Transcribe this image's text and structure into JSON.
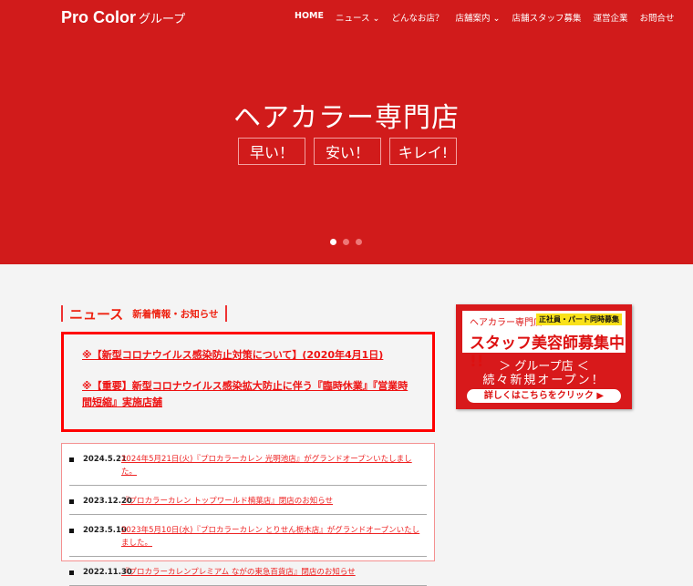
{
  "header": {
    "logo": "Pro Color",
    "logo_sub": "グループ",
    "nav": [
      "HOME",
      "ニュース ⌄",
      "どんなお店？",
      "店舗案内 ⌄",
      "店舗スタッフ募集",
      "運営企業",
      "お問合せ"
    ]
  },
  "hero": {
    "title": "ヘアカラー専門店",
    "taglines": [
      "早い！",
      "安い！",
      "キレイ!"
    ],
    "slide_count": 3,
    "active_slide": 1
  },
  "news": {
    "title": "ニュース",
    "subtitle": "新着情報・お知らせ",
    "notices": [
      "※【新型コロナウイルス感染防止対策について】(2020年4月1日)",
      "※【重要】新型コロナウイルス感染拡大防止に伴う『臨時休業』『営業時間短縮』実施店舗"
    ],
    "items": [
      {
        "date": "2024.5.21",
        "text": "2024年5月21日(火)『プロカラーカレン 光明池店』がグランドオープンいたしました。"
      },
      {
        "date": "2023.12.20",
        "text": "『プロカラーカレン トップワールド楠葉店』閉店のお知らせ"
      },
      {
        "date": "2023.5.10",
        "text": "2023年5月10日(水)『プロカラーカレン とりせん栃木店』がグランドオープンいたしました。"
      },
      {
        "date": "2022.11.30",
        "text": "『プロカラーカレンプレミアム ながの東急百貨店』閉店のお知らせ"
      }
    ]
  },
  "banner": {
    "line1": "ヘアカラー専門店",
    "badge": "正社員・パート同時募集",
    "line2": "スタッフ美容師募集中 !!",
    "line3": "＞ グループ店 ＜",
    "line4": "続々新規オープン！",
    "button": "詳しくはこちらをクリック ▶"
  }
}
